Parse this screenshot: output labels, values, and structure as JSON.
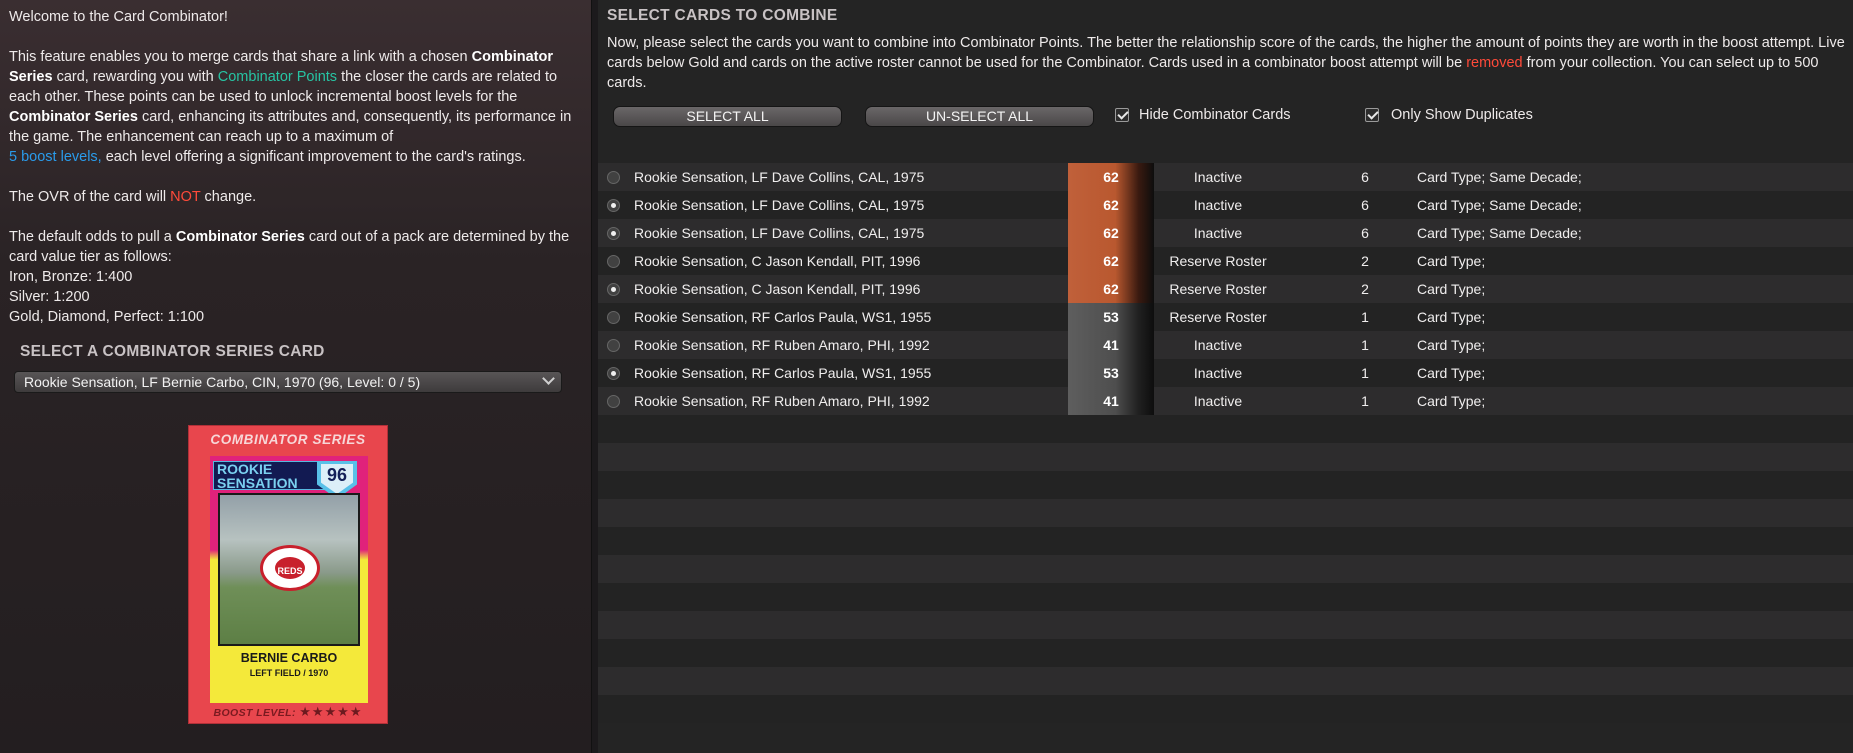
{
  "left": {
    "welcome": "Welcome to the Card Combinator!",
    "p1": {
      "a": "This feature enables you to merge cards that share a link with a chosen ",
      "b1": "Combinator Series",
      "c": " card, rewarding you with ",
      "teal": "Combinator Points",
      "d": " the closer the cards are related to each other. These points can be used to unlock incremental boost levels for the ",
      "b2": "Combinator Series",
      "e": " card, enhancing its attributes and, consequently, its performance in the game. The enhancement can reach up to a maximum of ",
      "blue": "5 boost levels,",
      "f": " each level offering a significant improvement to the card's ratings."
    },
    "p2": {
      "a": "The OVR of the card will ",
      "red": "NOT",
      "b": " change."
    },
    "p3": {
      "a": "The default odds to pull a ",
      "b1": "Combinator Series",
      "c": " card out of a pack are determined by the card value tier as follows:",
      "lines": [
        "Iron, Bronze: 1:400",
        "Silver: 1:200",
        "Gold, Diamond, Perfect: 1:100"
      ]
    },
    "section_title": "SELECT A COMBINATOR SERIES CARD",
    "dropdown_value": "Rookie Sensation, LF Bernie Carbo, CIN, 1970 (96, Level: 0 / 5)",
    "card": {
      "series": "COMBINATOR SERIES",
      "tag_line1": "ROOKIE",
      "tag_line2": "SENSATION",
      "ovr": "96",
      "logo_text": "REDS",
      "name": "BERNIE CARBO",
      "position": "LEFT FIELD / 1970",
      "boost": "BOOST LEVEL:",
      "stars": "★★★★★"
    }
  },
  "right": {
    "title": "SELECT CARDS TO COMBINE",
    "desc": {
      "a": "Now, please select the cards you want to combine into Combinator Points. The better the relationship score of the cards, the higher the amount of points they are worth in the boost attempt. Live cards below Gold and cards on the active roster cannot be used for the Combinator. Cards used in a combinator boost attempt will be ",
      "red": "removed",
      "b": " from your collection. You can select up to 500 cards."
    },
    "select_all": "SELECT ALL",
    "unselect_all": "UN-SELECT ALL",
    "hide_combinator": "Hide Combinator Cards",
    "only_duplicates": "Only Show Duplicates",
    "rows": [
      {
        "name": "Rookie Sensation, LF Dave Collins, CAL, 1975",
        "ovr": "62",
        "status": "Inactive",
        "score": "6",
        "link": "Card Type; Same Decade;"
      },
      {
        "name": "Rookie Sensation, LF Dave Collins, CAL, 1975",
        "ovr": "62",
        "status": "Inactive",
        "score": "6",
        "link": "Card Type; Same Decade;"
      },
      {
        "name": "Rookie Sensation, LF Dave Collins, CAL, 1975",
        "ovr": "62",
        "status": "Inactive",
        "score": "6",
        "link": "Card Type; Same Decade;"
      },
      {
        "name": "Rookie Sensation, C Jason Kendall, PIT, 1996",
        "ovr": "62",
        "status": "Reserve Roster",
        "score": "2",
        "link": "Card Type;"
      },
      {
        "name": "Rookie Sensation, C Jason Kendall, PIT, 1996",
        "ovr": "62",
        "status": "Reserve Roster",
        "score": "2",
        "link": "Card Type;"
      },
      {
        "name": "Rookie Sensation, RF Carlos Paula, WS1, 1955",
        "ovr": "53",
        "status": "Reserve Roster",
        "score": "1",
        "link": "Card Type;"
      },
      {
        "name": "Rookie Sensation, RF Ruben Amaro, PHI, 1992",
        "ovr": "41",
        "status": "Inactive",
        "score": "1",
        "link": "Card Type;"
      },
      {
        "name": "Rookie Sensation, RF Carlos Paula, WS1, 1955",
        "ovr": "53",
        "status": "Inactive",
        "score": "1",
        "link": "Card Type;"
      },
      {
        "name": "Rookie Sensation, RF Ruben Amaro, PHI, 1992",
        "ovr": "41",
        "status": "Inactive",
        "score": "1",
        "link": "Card Type;"
      }
    ]
  },
  "colors": {
    "teal": "#27c3a3",
    "blue": "#2a9bea",
    "red": "#ff4a3a",
    "bronze": "#c0603a",
    "iron": "#4a4a4a"
  }
}
